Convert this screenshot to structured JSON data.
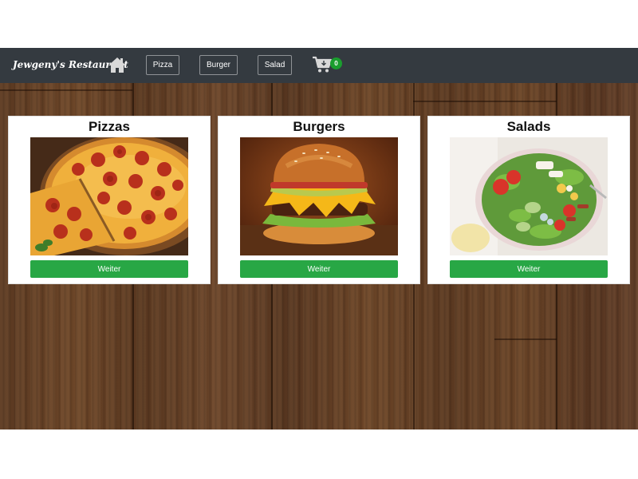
{
  "navbar": {
    "brand": "Jewgeny's Restaurant",
    "home_icon": "home-icon",
    "links": [
      "Pizza",
      "Burger",
      "Salad"
    ],
    "cart_icon": "cart-icon",
    "cart_count": "0",
    "background": "#343a40"
  },
  "cards": [
    {
      "title": "Pizzas",
      "button": "Weiter",
      "image": "pizza-photo"
    },
    {
      "title": "Burgers",
      "button": "Weiter",
      "image": "burger-photo"
    },
    {
      "title": "Salads",
      "button": "Weiter",
      "image": "salad-photo"
    }
  ],
  "colors": {
    "button": "#28a745",
    "badge": "#1a9e2e",
    "wood": "#6b452a"
  }
}
